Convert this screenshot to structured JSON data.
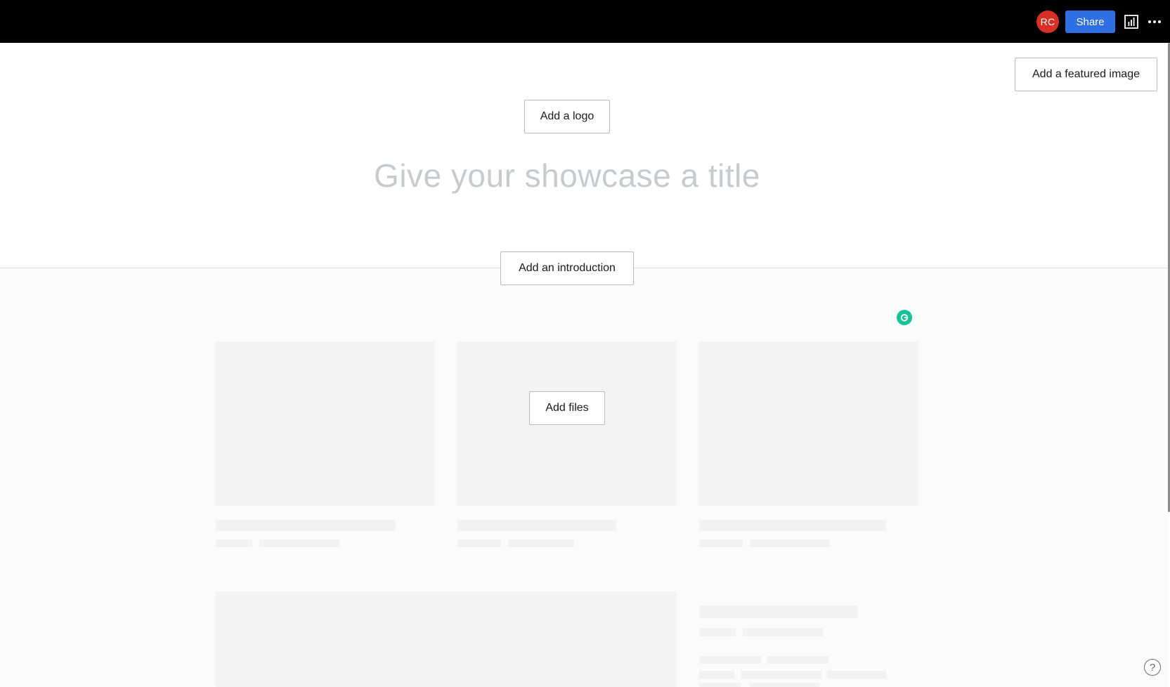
{
  "topbar": {
    "avatar_initials": "RC",
    "avatar_color": "#d93025",
    "share_label": "Share",
    "share_color": "#2f6fe4",
    "stats_icon": "bar-chart-icon",
    "more_icon": "more-horizontal-icon"
  },
  "header": {
    "featured_image_label": "Add a featured image",
    "logo_label": "Add a logo",
    "title_placeholder": "Give your showcase a title",
    "title_value": "",
    "introduction_label": "Add an introduction"
  },
  "content": {
    "add_files_label": "Add files",
    "grammarly_icon": "grammarly-icon",
    "grammarly_color": "#15c39a"
  },
  "footer": {
    "help_label": "?",
    "help_icon": "help-circle-icon"
  }
}
